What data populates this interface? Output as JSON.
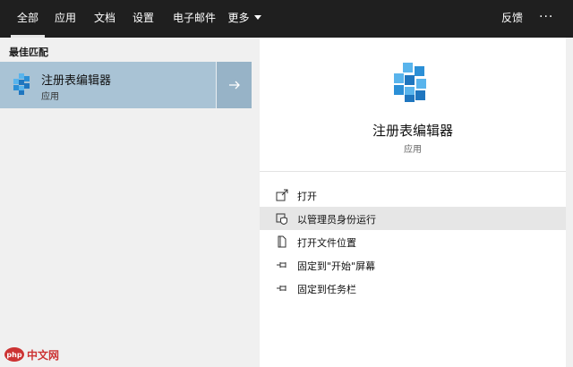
{
  "tabs": [
    {
      "label": "全部"
    },
    {
      "label": "应用"
    },
    {
      "label": "文档"
    },
    {
      "label": "设置"
    },
    {
      "label": "电子邮件"
    },
    {
      "label": "更多"
    }
  ],
  "topbar": {
    "feedback": "反馈",
    "more_options": "···"
  },
  "best_match": {
    "section_title": "最佳匹配",
    "name": "注册表编辑器",
    "type": "应用",
    "icon": "registry-editor-icon",
    "arrow_icon": "arrow-right-icon"
  },
  "detail": {
    "name": "注册表编辑器",
    "type": "应用",
    "icon": "registry-editor-icon"
  },
  "actions": [
    {
      "label": "打开",
      "icon": "open-icon"
    },
    {
      "label": "以管理员身份运行",
      "icon": "run-as-admin-icon"
    },
    {
      "label": "打开文件位置",
      "icon": "file-location-icon"
    },
    {
      "label": "固定到\"开始\"屏幕",
      "icon": "pin-icon"
    },
    {
      "label": "固定到任务栏",
      "icon": "pin-icon"
    }
  ],
  "watermark": {
    "text": "中文网"
  },
  "colors": {
    "topbar": "#1f1f1f",
    "selected": "#a9c3d5",
    "icon_blue": "#2b8fd6"
  }
}
